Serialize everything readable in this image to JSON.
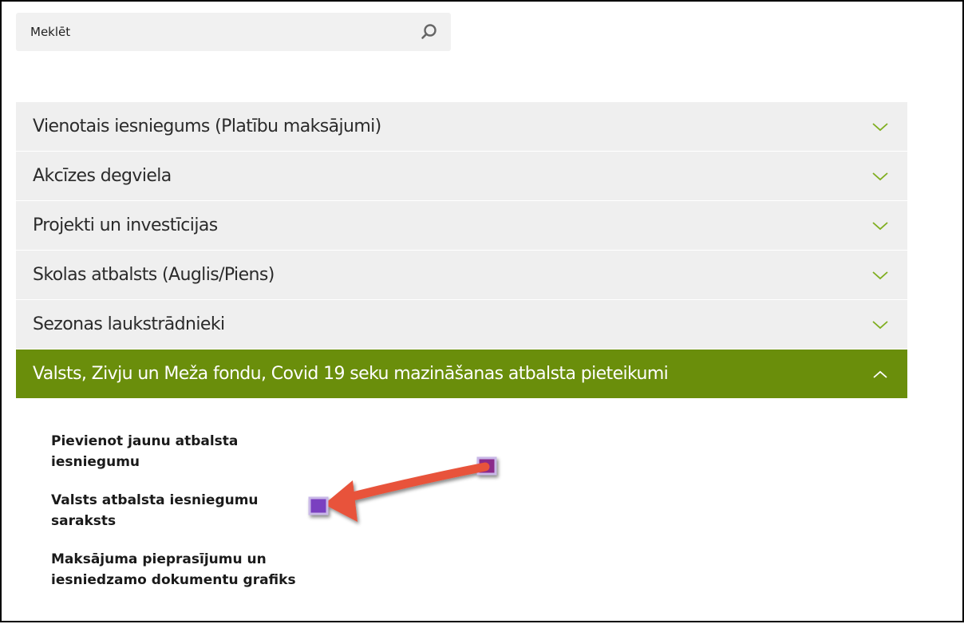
{
  "search": {
    "value": "Meklēt"
  },
  "accordion": {
    "items": [
      {
        "label": "Vienotais iesniegums (Platību maksājumi)",
        "expanded": false
      },
      {
        "label": "Akcīzes degviela",
        "expanded": false
      },
      {
        "label": "Projekti un investīcijas",
        "expanded": false
      },
      {
        "label": "Skolas atbalsts (Auglis/Piens)",
        "expanded": false
      },
      {
        "label": "Sezonas laukstrādnieki",
        "expanded": false
      },
      {
        "label": "Valsts, Zivju un Meža fondu, Covid 19 seku mazināšanas atbalsta pieteikumi",
        "expanded": true
      }
    ],
    "sub_links": [
      "Pievienot jaunu atbalsta iesniegumu",
      "Valsts atbalsta iesniegumu saraksts",
      "Maksājuma pieprasījumu un iesniedzamo dokumentu grafiks"
    ]
  },
  "colors": {
    "active_header": "#6a8e0b",
    "inactive_header": "#efefef",
    "chevron": "#7fae1f",
    "annotation_arrow": "#e8533a"
  },
  "icons": {
    "search": "search-icon",
    "collapsed": "chevron-down-icon",
    "expanded": "chevron-up-icon",
    "annotation": "arrow-annotation"
  }
}
